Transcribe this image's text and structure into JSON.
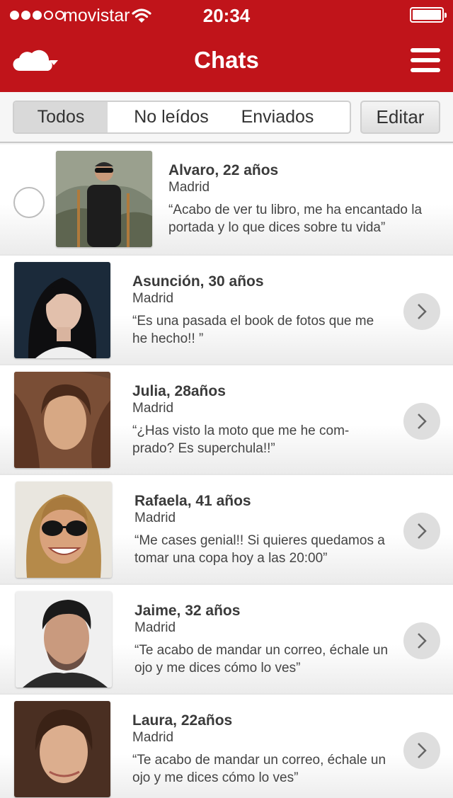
{
  "status": {
    "carrier": "movistar",
    "time": "20:34",
    "signal_bars": 3,
    "signal_total": 5
  },
  "header": {
    "title": "Chats",
    "left_icon": "cloud-dropdown-icon",
    "right_icon": "hamburger-menu-icon",
    "color": "#c0141a"
  },
  "tabs": {
    "items": [
      {
        "label": "Todos",
        "active": true
      },
      {
        "label": "No leídos",
        "active": false
      },
      {
        "label": "Enviados",
        "active": false
      }
    ],
    "edit_label": "Editar"
  },
  "chats": [
    {
      "name": "Alvaro, 22 años",
      "city": "Madrid",
      "message": "“Acabo de ver tu libro, me ha encantado la portada y lo que dices sobre tu vida”",
      "selectable": true
    },
    {
      "name": "Asunción, 30 años",
      "city": "Madrid",
      "message": "“Es una pasada el book de fotos que me he hecho!! ”",
      "selectable": false
    },
    {
      "name": "Julia, 28años",
      "city": "Madrid",
      "message": "“¿Has visto la moto que me he com-prado? Es superchula!!”",
      "selectable": false
    },
    {
      "name": "Rafaela, 41 años",
      "city": "Madrid",
      "message": "“Me cases genial!! Si quieres quedamos a tomar una copa hoy a las 20:00”",
      "selectable": false
    },
    {
      "name": "Jaime, 32 años",
      "city": "Madrid",
      "message": "“Te acabo de mandar un correo, échale un ojo y me dices cómo lo ves”",
      "selectable": false
    },
    {
      "name": "Laura, 22años",
      "city": "Madrid",
      "message": "“Te acabo de mandar un correo, échale un ojo y me dices cómo lo ves”",
      "selectable": false
    }
  ]
}
